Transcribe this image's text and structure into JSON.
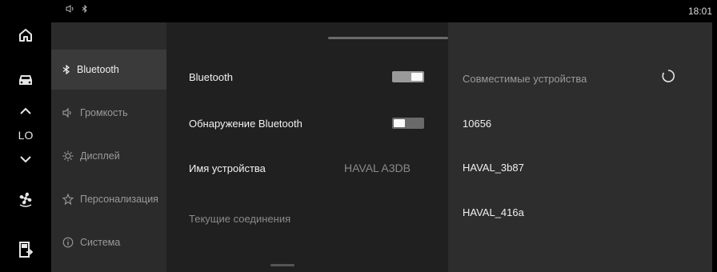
{
  "status_bar": {
    "time": "18:01",
    "icons": [
      "volume-icon",
      "bluetooth-icon"
    ]
  },
  "left_rail": {
    "temp_label": "LO",
    "buttons": [
      "home-icon",
      "car-icon",
      "fan-icon",
      "door-exit-icon"
    ]
  },
  "nav": {
    "items": [
      {
        "label": "Bluetooth",
        "icon": "bluetooth-icon",
        "active": true
      },
      {
        "label": "Громкость",
        "icon": "volume-icon",
        "active": false
      },
      {
        "label": "Дисплей",
        "icon": "brightness-icon",
        "active": false
      },
      {
        "label": "Персонализация",
        "icon": "personalization-icon",
        "active": false
      },
      {
        "label": "Система",
        "icon": "info-icon",
        "active": false
      }
    ]
  },
  "settings": {
    "bluetooth_label": "Bluetooth",
    "bluetooth_on": true,
    "discovery_label": "Обнаружение Bluetooth",
    "discovery_on": false,
    "device_name_label": "Имя устройства",
    "device_name_value": "HAVAL A3DB",
    "current_connections_label": "Текущие соединения"
  },
  "compatible": {
    "title": "Совместимые устройства",
    "devices": [
      "10656",
      "HAVAL_3b87",
      "HAVAL_416a"
    ]
  },
  "colors": {
    "background": "#262626",
    "active_nav": "#3a3a3a",
    "text": "#f0f0f0"
  }
}
